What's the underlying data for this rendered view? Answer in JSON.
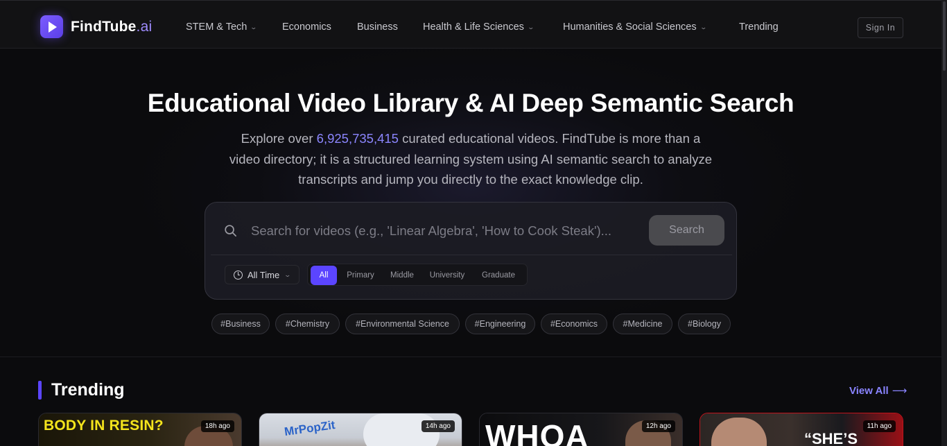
{
  "brand": {
    "name": "FindTube",
    "suffix": ".ai"
  },
  "nav": {
    "items": [
      {
        "label": "STEM & Tech",
        "dropdown": true
      },
      {
        "label": "Economics",
        "dropdown": false
      },
      {
        "label": "Business",
        "dropdown": false
      },
      {
        "label": "Health & Life Sciences",
        "dropdown": true
      },
      {
        "label": "Humanities & Social Sciences",
        "dropdown": true
      },
      {
        "label": "Trending",
        "dropdown": false
      }
    ],
    "sign_in": "Sign In"
  },
  "hero": {
    "title": "Educational Video Library & AI Deep Semantic Search",
    "desc_prefix": "Explore over ",
    "video_count": "6,925,735,415",
    "desc_suffix": " curated educational videos. FindTube is more than a video directory; it is a structured learning system using AI semantic search to analyze transcripts and jump you directly to the exact knowledge clip."
  },
  "search": {
    "placeholder": "Search for videos (e.g., 'Linear Algebra', 'How to Cook Steak')...",
    "button": "Search",
    "time_filter": "All Time",
    "levels": [
      "All",
      "Primary",
      "Middle",
      "University",
      "Graduate"
    ],
    "active_level": "All"
  },
  "tags": [
    "#Business",
    "#Chemistry",
    "#Environmental Science",
    "#Engineering",
    "#Economics",
    "#Medicine",
    "#Biology"
  ],
  "trending": {
    "title": "Trending",
    "view_all": "View All",
    "arrow": "⟶",
    "cards": [
      {
        "time": "18h ago",
        "thumb_text": "BODY IN RESIN?"
      },
      {
        "time": "14h ago",
        "thumb_text": "MrPopZit"
      },
      {
        "time": "12h ago",
        "thumb_text": "WHOA"
      },
      {
        "time": "11h ago",
        "thumb_text": "“SHE’S"
      }
    ]
  },
  "colors": {
    "accent": "#5b45ff",
    "count_highlight": "#8c86ff",
    "background": "#0b0b0d"
  },
  "icons": {
    "logo": "play-icon",
    "search": "search-icon",
    "time": "clock-icon",
    "dropdown": "chevron-down-icon"
  }
}
